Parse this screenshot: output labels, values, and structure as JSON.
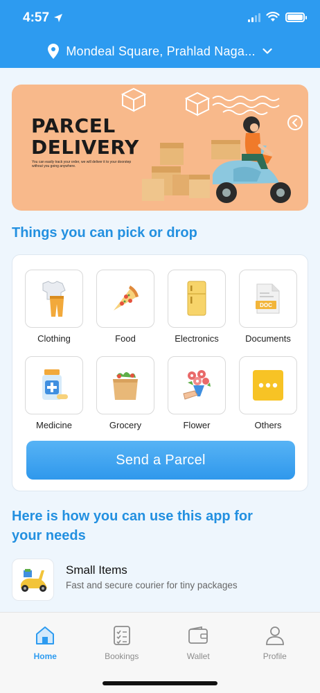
{
  "status_bar": {
    "time": "4:57"
  },
  "header": {
    "location": "Mondeal Square, Prahlad Naga..."
  },
  "banner": {
    "title_line1": "PARCEL",
    "title_line2": "DELIVERY",
    "subtitle": "You can easily track your order, we will deliver it to your doorstep without you going anywhere."
  },
  "pick_section": {
    "title": "Things you can pick or  drop"
  },
  "categories": [
    {
      "label": "Clothing",
      "icon": "clothing-icon"
    },
    {
      "label": "Food",
      "icon": "pizza-icon"
    },
    {
      "label": "Electronics",
      "icon": "fridge-icon"
    },
    {
      "label": "Documents",
      "icon": "document-icon"
    },
    {
      "label": "Medicine",
      "icon": "medicine-icon"
    },
    {
      "label": "Grocery",
      "icon": "grocery-bag-icon"
    },
    {
      "label": "Flower",
      "icon": "flower-bouquet-icon"
    },
    {
      "label": "Others",
      "icon": "more-dots-icon"
    }
  ],
  "doc_badge": "DOC",
  "send_button": {
    "label": "Send a Parcel"
  },
  "use_section": {
    "title_line1": "Here is how you can use this app for",
    "title_line2": "your needs",
    "items": [
      {
        "title": "Small Items",
        "description": "Fast and secure courier for tiny packages",
        "icon": "scooter-icon"
      }
    ]
  },
  "bottom_nav": {
    "active": "Home",
    "items": [
      {
        "label": "Home",
        "icon": "home-icon"
      },
      {
        "label": "Bookings",
        "icon": "checklist-icon"
      },
      {
        "label": "Wallet",
        "icon": "wallet-icon"
      },
      {
        "label": "Profile",
        "icon": "user-icon"
      }
    ]
  },
  "colors": {
    "primary": "#2d9bf0",
    "banner_bg": "#f8b98b",
    "section_title": "#2390e0",
    "others_tile": "#f7c325"
  }
}
